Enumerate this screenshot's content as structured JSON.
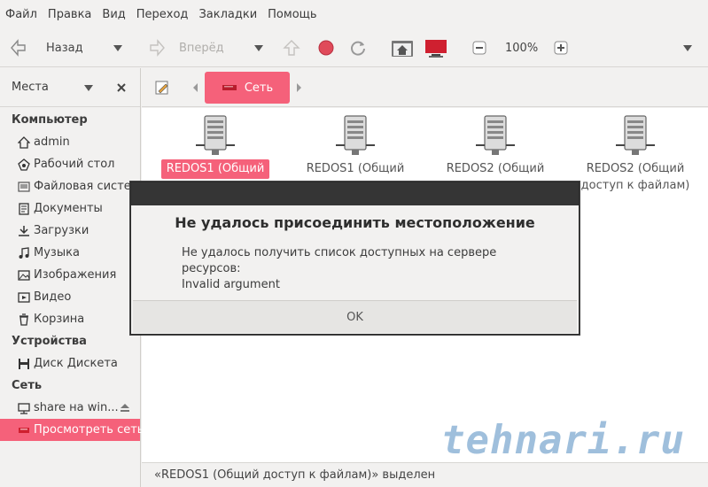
{
  "menu": [
    "Файл",
    "Правка",
    "Вид",
    "Переход",
    "Закладки",
    "Помощь"
  ],
  "toolbar": {
    "back_label": "Назад",
    "forward_label": "Вперёд",
    "zoom": "100%"
  },
  "sidebar": {
    "header": "Места",
    "sections": [
      {
        "title": "Компьютер",
        "items": [
          {
            "label": "admin",
            "icon": "home-icon"
          },
          {
            "label": "Рабочий стол",
            "icon": "desktop-icon"
          },
          {
            "label": "Файловая систе...",
            "icon": "filesystem-icon"
          },
          {
            "label": "Документы",
            "icon": "documents-icon"
          },
          {
            "label": "Загрузки",
            "icon": "downloads-icon"
          },
          {
            "label": "Музыка",
            "icon": "music-icon"
          },
          {
            "label": "Изображения",
            "icon": "pictures-icon"
          },
          {
            "label": "Видео",
            "icon": "video-icon"
          },
          {
            "label": "Корзина",
            "icon": "trash-icon"
          }
        ]
      },
      {
        "title": "Устройства",
        "items": [
          {
            "label": "Диск Дискета",
            "icon": "floppy-icon"
          }
        ]
      },
      {
        "title": "Сеть",
        "items": [
          {
            "label": "share на win...",
            "icon": "network-share-icon"
          },
          {
            "label": "Просмотреть сеть",
            "icon": "network-icon"
          }
        ]
      }
    ]
  },
  "location": {
    "current": "Сеть"
  },
  "files": [
    {
      "line1": "REDOS1 (Общий",
      "line2": "",
      "selected": true
    },
    {
      "line1": "REDOS1 (Общий",
      "line2": "",
      "selected": false
    },
    {
      "line1": "REDOS2 (Общий",
      "line2": "",
      "selected": false
    },
    {
      "line1": "REDOS2 (Общий",
      "line2": "доступ к файлам)",
      "selected": false
    }
  ],
  "status": "«REDOS1 (Общий доступ к файлам)» выделен",
  "watermark": "tehnari.ru",
  "dialog": {
    "title": "Не удалось присоединить местоположение",
    "message_line1": "Не удалось получить список доступных на сервере ресурсов:",
    "message_line2": "Invalid argument",
    "ok_label": "OK"
  },
  "colors": {
    "accent": "#f5617a",
    "dialog_titlebar": "#353535"
  }
}
